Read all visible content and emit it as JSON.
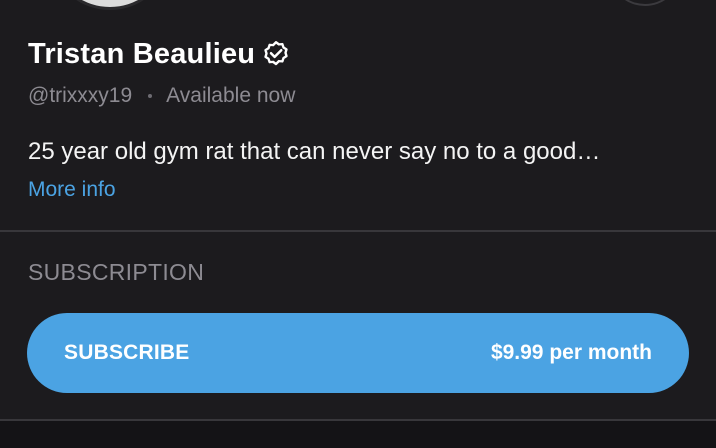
{
  "profile": {
    "name": "Tristan Beaulieu",
    "handle": "@trixxxy19",
    "status": "Available now",
    "bio": "25 year old gym rat that can never say no to a good…",
    "more_info_label": "More info"
  },
  "subscription": {
    "heading": "SUBSCRIPTION",
    "button_label": "SUBSCRIBE",
    "price": "$9.99 per month"
  },
  "colors": {
    "background": "#1c1b1e",
    "accent": "#4ba3e3",
    "muted_text": "#8d8b92"
  },
  "icons": {
    "verified": "verified-badge-icon"
  }
}
